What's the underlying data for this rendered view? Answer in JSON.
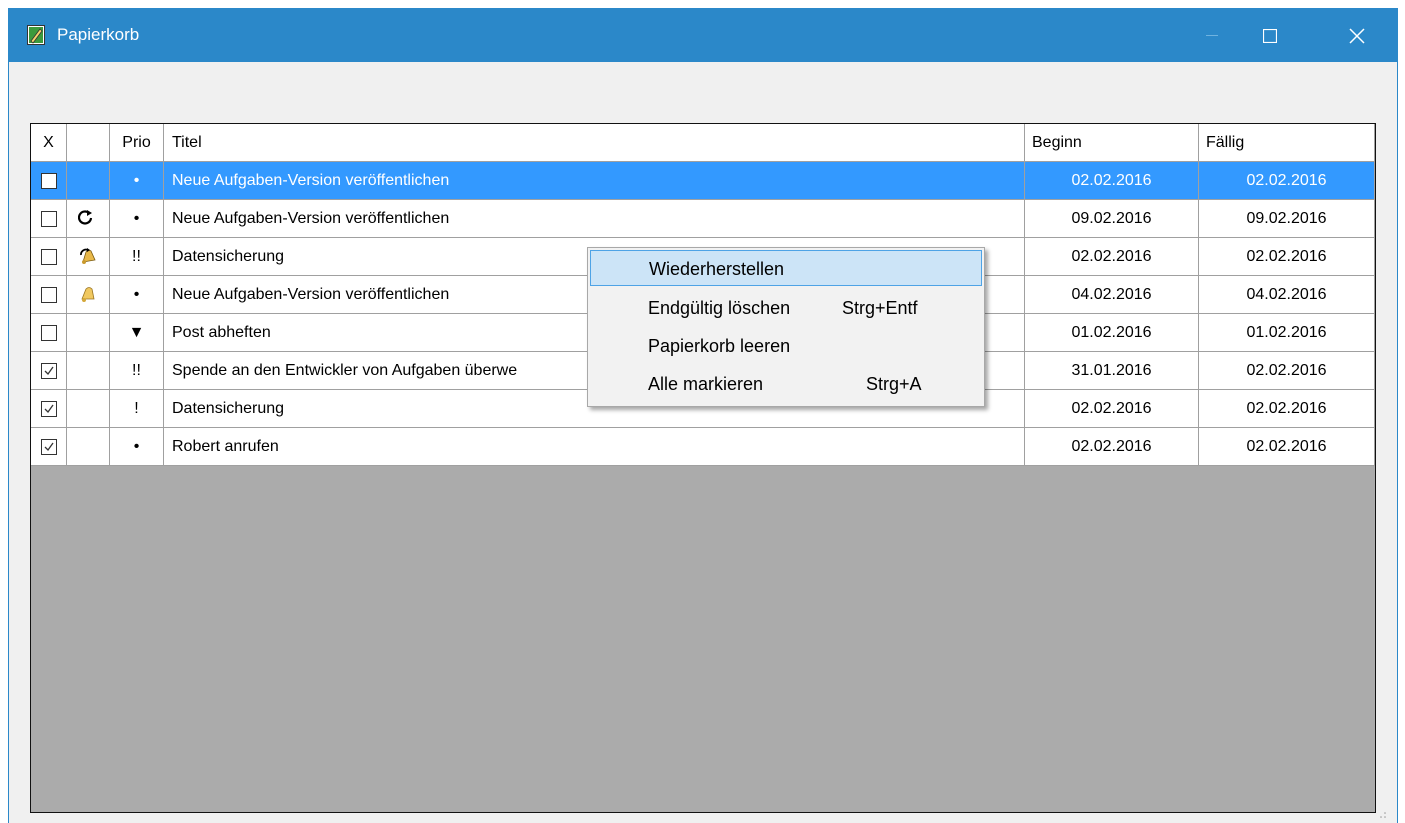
{
  "window": {
    "title": "Papierkorb"
  },
  "grid": {
    "headers": {
      "x": "X",
      "icon": "",
      "prio": "Prio",
      "title": "Titel",
      "begin": "Beginn",
      "due": "Fällig"
    },
    "rows": [
      {
        "checked": false,
        "icon": "",
        "prio": "•",
        "title": "Neue Aufgaben-Version veröffentlichen",
        "begin": "02.02.2016",
        "due": "02.02.2016",
        "selected": true
      },
      {
        "checked": false,
        "icon": "recurring-icon",
        "prio": "•",
        "title": "Neue Aufgaben-Version veröffentlichen",
        "begin": "09.02.2016",
        "due": "09.02.2016",
        "selected": false
      },
      {
        "checked": false,
        "icon": "recurring-reminder-bell-icon",
        "prio": "!!",
        "title": "Datensicherung",
        "begin": "02.02.2016",
        "due": "02.02.2016",
        "selected": false
      },
      {
        "checked": false,
        "icon": "reminder-bell-icon",
        "prio": "•",
        "title": "Neue Aufgaben-Version veröffentlichen",
        "begin": "04.02.2016",
        "due": "04.02.2016",
        "selected": false
      },
      {
        "checked": false,
        "icon": "",
        "prio": "▼",
        "title": "Post abheften",
        "begin": "01.02.2016",
        "due": "01.02.2016",
        "selected": false
      },
      {
        "checked": true,
        "icon": "",
        "prio": "!!",
        "title": "Spende an den Entwickler von Aufgaben überwe",
        "begin": "31.01.2016",
        "due": "02.02.2016",
        "selected": false
      },
      {
        "checked": true,
        "icon": "",
        "prio": "!",
        "title": "Datensicherung",
        "begin": "02.02.2016",
        "due": "02.02.2016",
        "selected": false
      },
      {
        "checked": true,
        "icon": "",
        "prio": "•",
        "title": "Robert anrufen",
        "begin": "02.02.2016",
        "due": "02.02.2016",
        "selected": false
      }
    ]
  },
  "context_menu": {
    "items": [
      {
        "label": "Wiederherstellen",
        "shortcut": ""
      },
      {
        "label": "Endgültig löschen",
        "shortcut": "Strg+Entf"
      },
      {
        "label": "Papierkorb leeren",
        "shortcut": ""
      },
      {
        "label": "Alle markieren",
        "shortcut": "Strg+A"
      }
    ]
  },
  "colors": {
    "titlebar": "#2b88c9",
    "selection": "#3399ff",
    "menu_highlight": "#cce4f7",
    "grid_empty": "#ababab"
  }
}
